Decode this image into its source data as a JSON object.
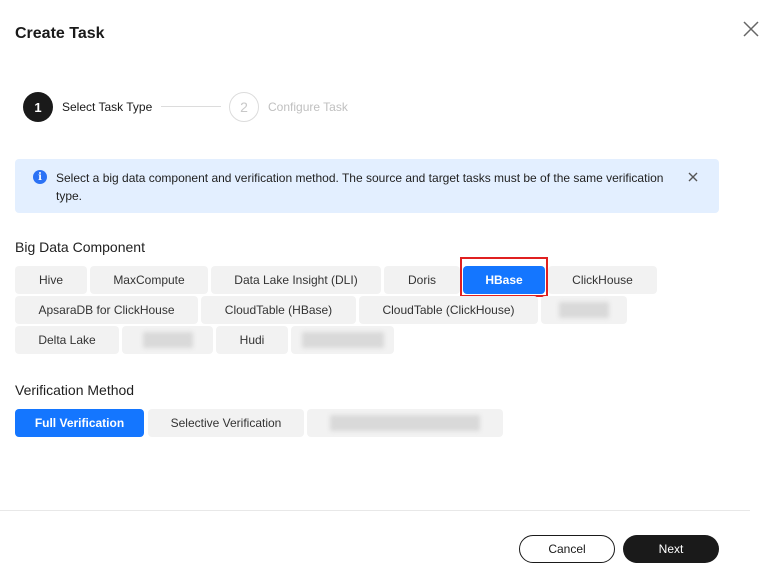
{
  "dialog": {
    "title": "Create Task"
  },
  "steps": [
    {
      "number": "1",
      "label": "Select Task Type",
      "state": "active"
    },
    {
      "number": "2",
      "label": "Configure Task",
      "state": "inactive"
    }
  ],
  "alert": {
    "text": "Select a big data component and verification method. The source and target tasks must be of the same verification type.",
    "icon": "info-icon"
  },
  "big_data_component": {
    "title": "Big Data Component",
    "selected": "HBase",
    "options": [
      "Hive",
      "MaxCompute",
      "Data Lake Insight (DLI)",
      "Doris",
      "HBase",
      "ClickHouse",
      "ApsaraDB for ClickHouse",
      "CloudTable (HBase)",
      "CloudTable (ClickHouse)",
      "",
      "Delta Lake",
      "",
      "Hudi",
      ""
    ]
  },
  "verification_method": {
    "title": "Verification Method",
    "selected": "Full Verification",
    "options": [
      "Full Verification",
      "Selective Verification",
      ""
    ]
  },
  "footer": {
    "cancel_label": "Cancel",
    "next_label": "Next"
  },
  "colors": {
    "accent": "#1476ff",
    "primary_dark": "#1a1a1a",
    "alert_bg": "#e3efff",
    "highlight": "#e02020"
  }
}
